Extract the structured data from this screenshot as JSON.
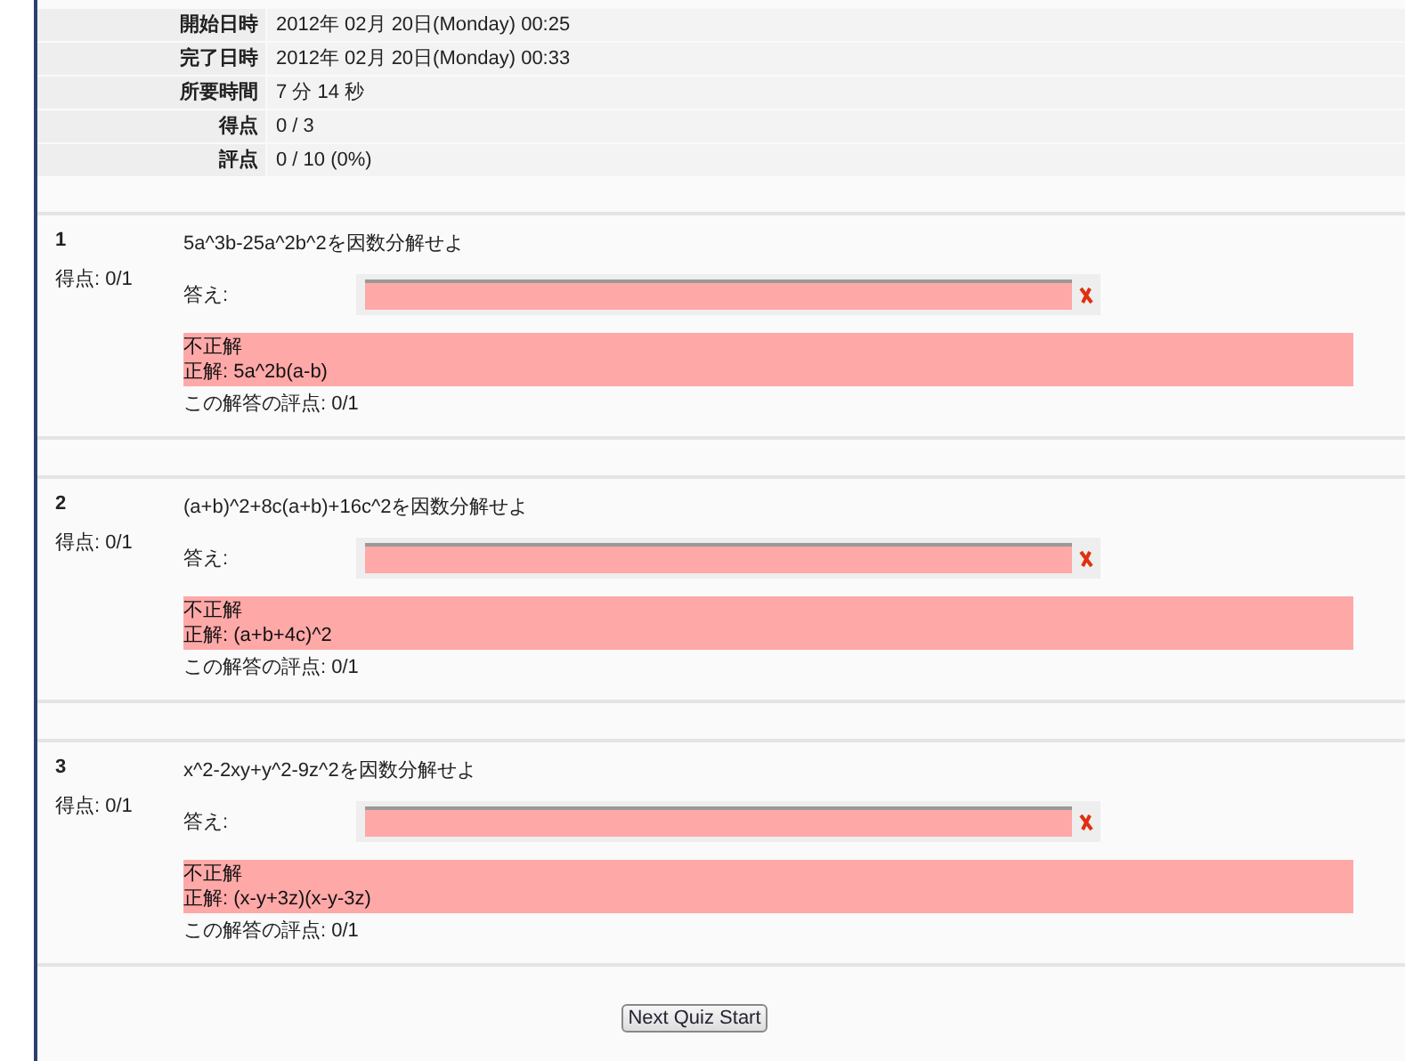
{
  "summary": [
    {
      "label": "開始日時",
      "value": "2012年 02月 20日(Monday) 00:25"
    },
    {
      "label": "完了日時",
      "value": "2012年 02月 20日(Monday) 00:33"
    },
    {
      "label": "所要時間",
      "value": "7 分 14 秒"
    },
    {
      "label": "得点",
      "value": "0 / 3"
    },
    {
      "label": "評点",
      "value": "0 / 10 (0%)"
    }
  ],
  "questions": [
    {
      "number": "1",
      "score": "得点: 0/1",
      "text": "5a^3b-25a^2b^2を因数分解せよ",
      "answer_label": "答え:",
      "correct": false,
      "feedback": "不正解",
      "correct_answer": "正解: 5a^2b(a-b)",
      "grade": "この解答の評点: 0/1"
    },
    {
      "number": "2",
      "score": "得点: 0/1",
      "text": "(a+b)^2+8c(a+b)+16c^2を因数分解せよ",
      "answer_label": "答え:",
      "correct": false,
      "feedback": "不正解",
      "correct_answer": "正解: (a+b+4c)^2",
      "grade": "この解答の評点: 0/1"
    },
    {
      "number": "3",
      "score": "得点: 0/1",
      "text": "x^2-2xy+y^2-9z^2を因数分解せよ",
      "answer_label": "答え:",
      "correct": false,
      "feedback": "不正解",
      "correct_answer": "正解: (x-y+3z)(x-y-3z)",
      "grade": "この解答の評点: 0/1"
    }
  ],
  "button": "Next Quiz Start"
}
